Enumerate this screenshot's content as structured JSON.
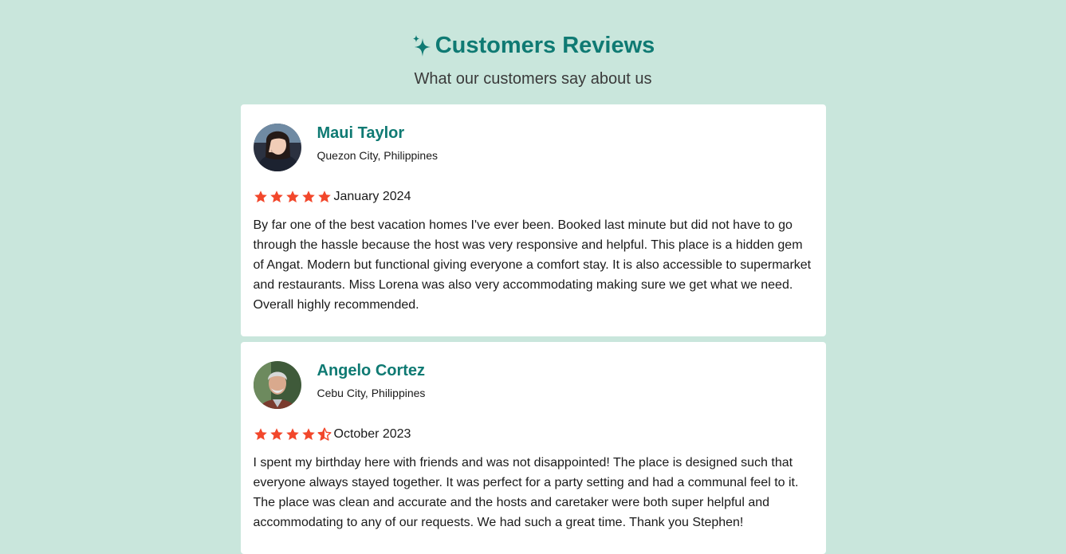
{
  "header": {
    "title": "Customers Reviews",
    "subtitle": "What our customers say about us",
    "title_icon": "sparkles-icon"
  },
  "colors": {
    "background": "#c9e6dc",
    "accent": "#0f7a73",
    "star": "#f2472b",
    "card": "#ffffff"
  },
  "reviews": [
    {
      "name": "Maui Taylor",
      "location": "Quezon City, Philippines",
      "rating": 5,
      "date": "January 2024",
      "text": "By far one of the best vacation homes I've ever been. Booked last minute but did not have to go through the hassle because the host was very responsive and helpful. This place is a hidden gem of Angat. Modern but functional giving everyone a comfort stay. It is also accessible to supermarket and restaurants. Miss Lorena was also very accommodating making sure we get what we need. Overall highly recommended."
    },
    {
      "name": "Angelo Cortez",
      "location": "Cebu City, Philippines",
      "rating": 4.5,
      "date": "October 2023",
      "text": "I spent my birthday here with friends and was not disappointed! The place is designed such that everyone always stayed together. It was perfect for a party setting and had a communal feel to it. The place was clean and accurate and the hosts and caretaker were both super helpful and accommodating to any of our requests. We had such a great time. Thank you Stephen!"
    }
  ]
}
